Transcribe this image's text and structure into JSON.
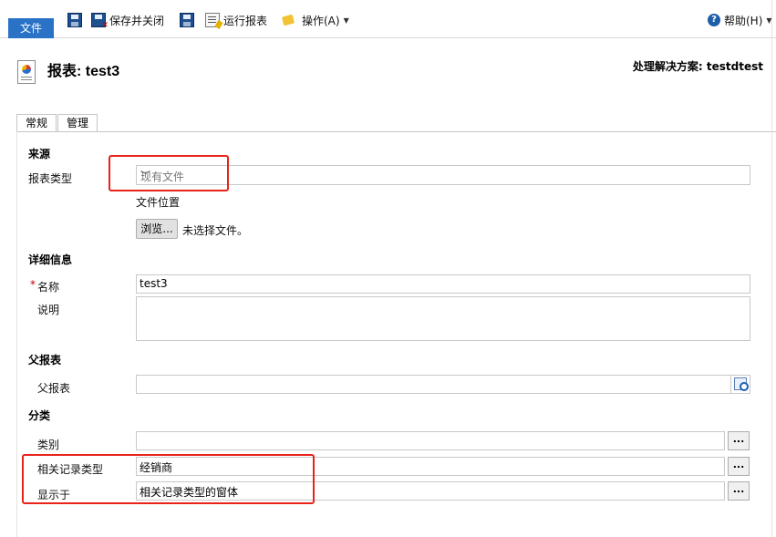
{
  "toolbar": {
    "file_label": "文件",
    "save_close_label": "保存并关闭",
    "run_report_label": "运行报表",
    "actions_label": "操作(A)",
    "help_label": "帮助(H)"
  },
  "header": {
    "title": "报表: test3",
    "solution": "处理解决方案: testdtest"
  },
  "tabs": [
    {
      "label": "常规"
    },
    {
      "label": "管理"
    }
  ],
  "source": {
    "section_title": "来源",
    "report_type_label": "报表类型",
    "report_type_value": "现有文件",
    "file_location_label": "文件位置",
    "browse_label": "浏览...",
    "no_file_text": "未选择文件。"
  },
  "details": {
    "section_title": "详细信息",
    "required_mark": "*",
    "name_label": "名称",
    "name_value": "test3",
    "description_label": "说明",
    "description_value": ""
  },
  "parent": {
    "section_title": "父报表",
    "parent_label": "父报表",
    "parent_value": ""
  },
  "category": {
    "section_title": "分类",
    "category_label": "类别",
    "category_value": "",
    "related_type_label": "相关记录类型",
    "related_type_value": "经销商",
    "display_in_label": "显示于",
    "display_in_value": "相关记录类型的窗体",
    "lookup_more_label": "..."
  },
  "colors": {
    "accent": "#2a72c5",
    "highlight": "#e8231b"
  }
}
